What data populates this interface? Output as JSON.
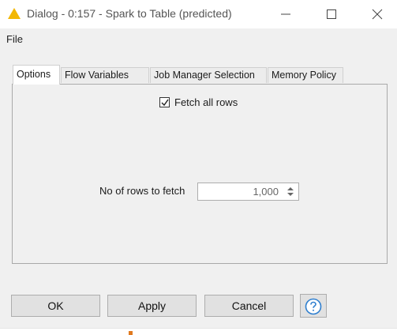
{
  "window": {
    "title": "Dialog - 0:157 - Spark to Table (predicted)",
    "icon": "warning-triangle-icon",
    "controls": [
      "minimize-icon",
      "maximize-icon",
      "close-icon"
    ]
  },
  "menu": {
    "file_label": "File"
  },
  "tabs": [
    {
      "label": "Options",
      "active": true
    },
    {
      "label": "Flow Variables",
      "active": false
    },
    {
      "label": "Job Manager Selection",
      "active": false
    },
    {
      "label": "Memory Policy",
      "active": false
    }
  ],
  "options": {
    "fetch_all_rows": {
      "label": "Fetch all rows",
      "checked": true
    },
    "rows_to_fetch": {
      "label": "No of rows to fetch",
      "value": "1,000"
    }
  },
  "buttons": {
    "ok": "OK",
    "apply": "Apply",
    "cancel": "Cancel",
    "help_icon": "help-question-icon"
  },
  "colors": {
    "warning": "#f2b705",
    "help": "#2f7fcf",
    "background": "#f0f0f0"
  }
}
